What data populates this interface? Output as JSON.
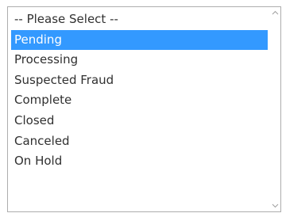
{
  "status_select": {
    "options": [
      {
        "label": "-- Please Select --",
        "selected": false
      },
      {
        "label": "Pending",
        "selected": true
      },
      {
        "label": "Processing",
        "selected": false
      },
      {
        "label": "Suspected Fraud",
        "selected": false
      },
      {
        "label": "Complete",
        "selected": false
      },
      {
        "label": "Closed",
        "selected": false
      },
      {
        "label": "Canceled",
        "selected": false
      },
      {
        "label": "On Hold",
        "selected": false
      }
    ]
  },
  "icons": {
    "scroll_up": "chevron-up-icon",
    "scroll_down": "chevron-down-icon"
  },
  "colors": {
    "selection_background": "#3399ff",
    "selection_text": "#ffffff",
    "text": "#303030",
    "border": "#adadad"
  }
}
